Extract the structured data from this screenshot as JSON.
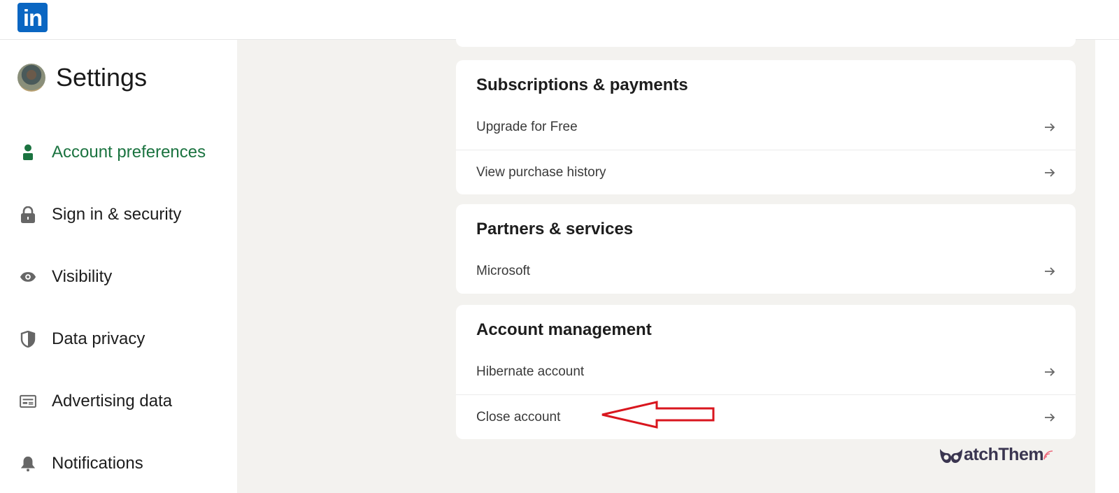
{
  "header": {
    "logo_text": "in",
    "logo_color": "#0a66c2"
  },
  "sidebar": {
    "title": "Settings",
    "active_color": "#1b7340",
    "items": [
      {
        "label": "Account preferences",
        "icon": "person-icon",
        "active": true
      },
      {
        "label": "Sign in & security",
        "icon": "lock-icon",
        "active": false
      },
      {
        "label": "Visibility",
        "icon": "eye-icon",
        "active": false
      },
      {
        "label": "Data privacy",
        "icon": "shield-icon",
        "active": false
      },
      {
        "label": "Advertising data",
        "icon": "ad-card-icon",
        "active": false
      },
      {
        "label": "Notifications",
        "icon": "bell-icon",
        "active": false
      }
    ]
  },
  "sections": [
    {
      "title": "Subscriptions & payments",
      "rows": [
        {
          "label": "Upgrade for Free"
        },
        {
          "label": "View purchase history"
        }
      ]
    },
    {
      "title": "Partners & services",
      "rows": [
        {
          "label": "Microsoft"
        }
      ]
    },
    {
      "title": "Account management",
      "rows": [
        {
          "label": "Hibernate account"
        },
        {
          "label": "Close account"
        }
      ]
    }
  ],
  "annotation": {
    "type": "red-arrow",
    "points_to": "Close account",
    "color": "#d9161e"
  },
  "watermark": {
    "text": "atchThem",
    "brand": "WatchThem"
  }
}
